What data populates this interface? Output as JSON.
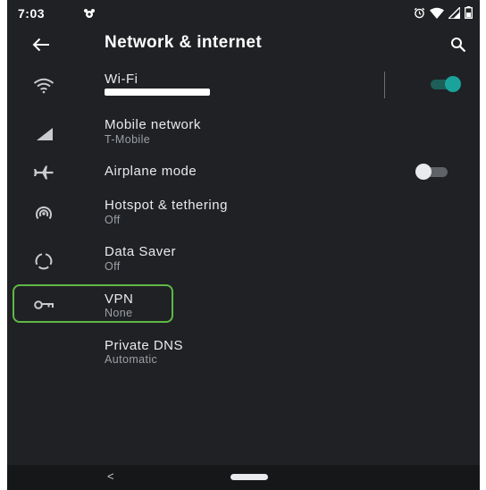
{
  "status_bar": {
    "time": "7:03",
    "notification_icon": "notification-app-icon",
    "icons": [
      "alarm-icon",
      "wifi-signal-icon",
      "cell-signal-icon",
      "battery-icon"
    ]
  },
  "app_bar": {
    "title": "Network & internet",
    "back_icon": "arrow-back-icon",
    "search_icon": "search-icon"
  },
  "items": [
    {
      "title": "Wi-Fi",
      "subtitle": "",
      "icon": "wifi-icon",
      "toggle": "on"
    },
    {
      "title": "Mobile network",
      "subtitle": "T-Mobile",
      "icon": "signal-icon"
    },
    {
      "title": "Airplane mode",
      "subtitle": "",
      "icon": "airplane-icon",
      "toggle": "off"
    },
    {
      "title": "Hotspot & tethering",
      "subtitle": "Off",
      "icon": "hotspot-icon"
    },
    {
      "title": "Data Saver",
      "subtitle": "Off",
      "icon": "data-saver-icon"
    },
    {
      "title": "VPN",
      "subtitle": "None",
      "icon": "vpn-key-icon"
    },
    {
      "title": "Private DNS",
      "subtitle": "Automatic",
      "icon": ""
    }
  ],
  "nav_bar": {
    "back_label": "<"
  },
  "colors": {
    "background": "#202124",
    "accent": "#1aa39a",
    "highlight": "#5fb846",
    "text_primary": "#e8eaed",
    "text_secondary": "#9aa0a6"
  }
}
